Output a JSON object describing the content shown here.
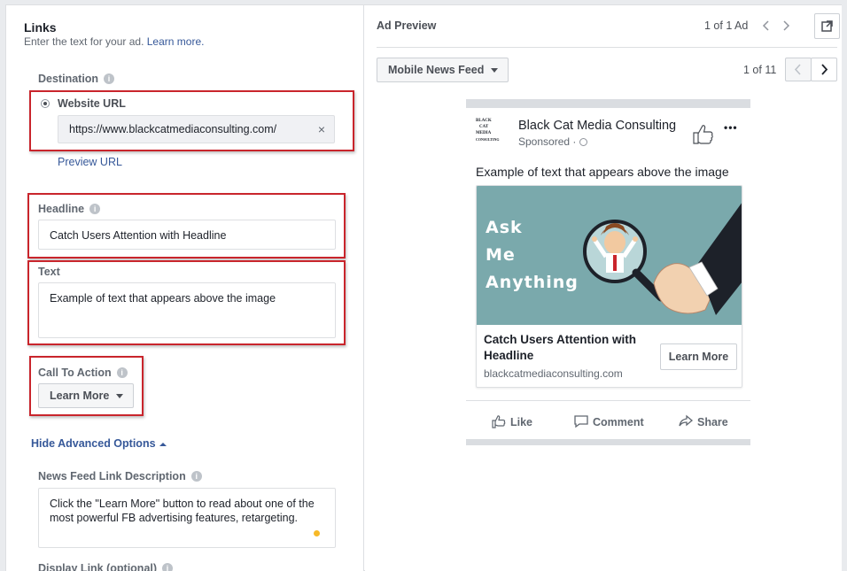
{
  "links": {
    "title": "Links",
    "subtitle": "Enter the text for your ad.",
    "learn_more_link": "Learn more.",
    "destination_label": "Destination",
    "website_url_label": "Website URL",
    "website_url_value": "https://www.blackcatmediaconsulting.com/",
    "clear_icon": "×",
    "preview_url": "Preview URL",
    "headline_label": "Headline",
    "headline_value": "Catch Users Attention with Headline",
    "text_label": "Text",
    "text_value": "Example of text that appears above the image",
    "cta_label": "Call To Action",
    "cta_value": "Learn More",
    "advanced_toggle": "Hide Advanced Options",
    "news_feed_desc_label": "News Feed Link Description",
    "news_feed_desc_value": "Click the \"Learn More\" button to read about one of the most powerful FB advertising features, retargeting.",
    "display_link_label": "Display Link (optional)",
    "info_glyph": "i"
  },
  "preview": {
    "title": "Ad Preview",
    "ad_count": "1 of 1 Ad",
    "placement": "Mobile News Feed",
    "page_count": "1 of 11",
    "page_name": "Black Cat Media Consulting",
    "sponsored": "Sponsored",
    "post_text": "Example of text that appears above the image",
    "image_text": [
      "Ask",
      "Me",
      "Anything"
    ],
    "card_headline": "Catch Users Attention with Headline",
    "card_domain": "blackcatmediaconsulting.com",
    "card_button": "Learn More",
    "logo_text": [
      "BLACK",
      "CAT",
      "MEDIA",
      "CONSULTING"
    ],
    "actions": [
      "Like",
      "Comment",
      "Share"
    ],
    "more_icon": "•••"
  },
  "colors": {
    "accent_blue": "#365899",
    "highlight_red": "#c9252c",
    "image_teal": "#7aa9ac",
    "status_dot": "#f7b928"
  }
}
